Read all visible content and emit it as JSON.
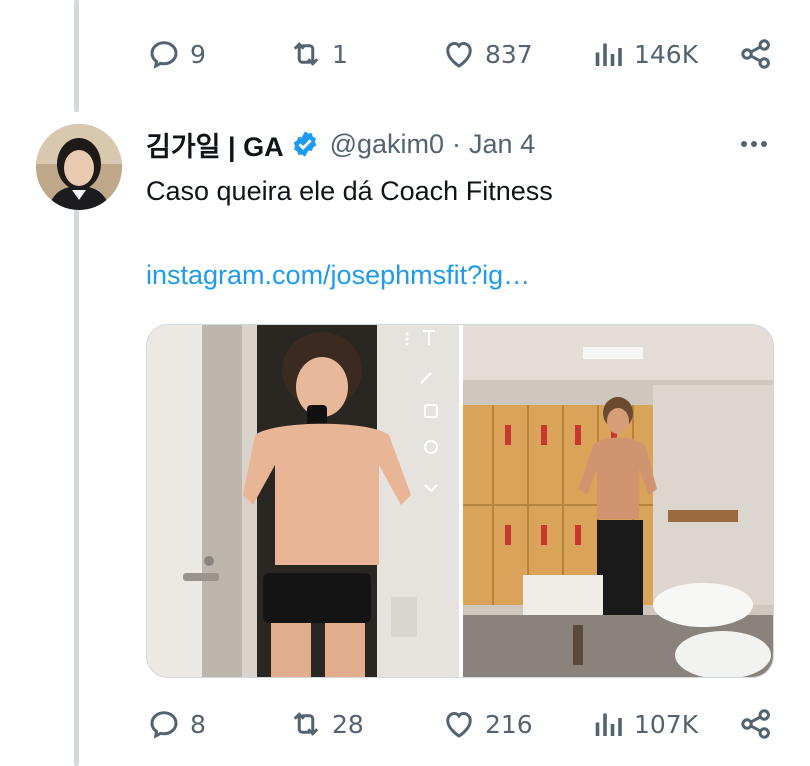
{
  "previous_tweet": {
    "replies": "9",
    "retweets": "1",
    "likes": "837",
    "views": "146K"
  },
  "tweet": {
    "author": {
      "display_name": "김가일 | GA",
      "handle": "@gakim0",
      "verified": true
    },
    "date": "Jan 4",
    "text": "Caso queira ele dá Coach Fitness",
    "link": "instagram.com/josephmsfit?ig…",
    "media": [
      {
        "description_icon": "before-photo"
      },
      {
        "description_icon": "after-photo"
      }
    ],
    "stats": {
      "replies": "8",
      "retweets": "28",
      "likes": "216",
      "views": "107K"
    }
  },
  "colors": {
    "accent": "#1d9bf0",
    "secondary_text": "#536471",
    "thread_line": "#cfd9de"
  }
}
